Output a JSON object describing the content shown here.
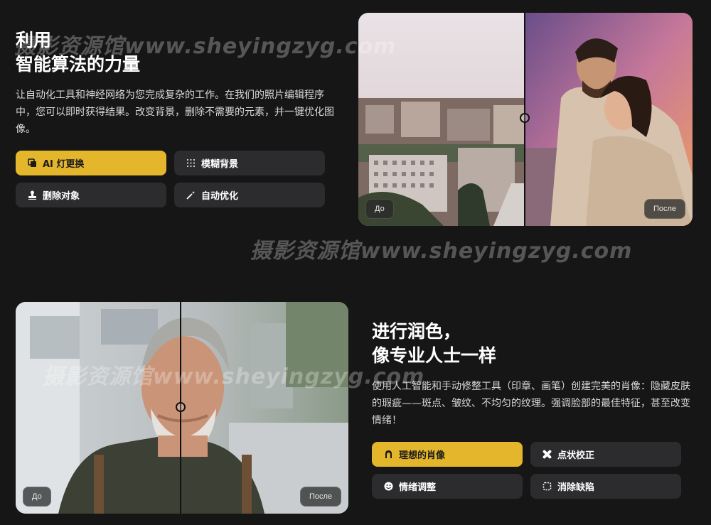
{
  "section1": {
    "title_line1": "利用",
    "title_line2": "智能算法的力量",
    "description": "让自动化工具和神经网络为您完成复杂的工作。在我们的照片编辑程序中，您可以即时获得结果。改变背景，删除不需要的元素，并一键优化图像。",
    "buttons": [
      {
        "label": "AI 灯更换",
        "icon": "layers-icon",
        "active": true
      },
      {
        "label": "模糊背景",
        "icon": "dots-grid-icon",
        "active": false
      },
      {
        "label": "删除对象",
        "icon": "stamp-icon",
        "active": false
      },
      {
        "label": "自动优化",
        "icon": "magic-wand-icon",
        "active": false
      }
    ],
    "before_label": "До",
    "after_label": "После"
  },
  "section2": {
    "title_line1": "进行润色，",
    "title_line2": "像专业人士一样",
    "description": "使用人工智能和手动修整工具（印章、画笔）创建完美的肖像：隐藏皮肤的瑕疵——斑点、皱纹、不均匀的纹理。强调脸部的最佳特征，甚至改变情绪！",
    "buttons": [
      {
        "label": "理想的肖像",
        "icon": "person-icon",
        "active": true
      },
      {
        "label": "点状校正",
        "icon": "bandage-icon",
        "active": false
      },
      {
        "label": "情绪调整",
        "icon": "smiley-icon",
        "active": false
      },
      {
        "label": "消除缺陷",
        "icon": "selection-icon",
        "active": false
      }
    ],
    "before_label": "До",
    "after_label": "После"
  },
  "watermarks": [
    "摄影资源馆www.sheyingzyg.com",
    "摄影资源馆www.sheyingzyg.com",
    "摄影资源馆www.sheyingzyg.com"
  ],
  "colors": {
    "background": "#161616",
    "accent": "#e4b62c",
    "button": "#2c2c2e"
  }
}
